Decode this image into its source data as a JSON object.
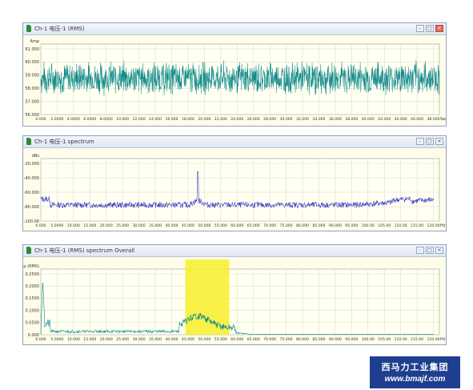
{
  "windows": [
    {
      "title": "Ch-1 电压-1 (RMS)",
      "buttons": [
        "-",
        "□",
        "×"
      ]
    },
    {
      "title": "Ch-1 电压-1 spectrum",
      "buttons": [
        "-",
        "□",
        "×"
      ]
    },
    {
      "title": "Ch-1 电压-1 (RMS) spectrum Overall",
      "buttons": [
        "-",
        "□",
        "×"
      ]
    }
  ],
  "chart_data": [
    {
      "type": "line",
      "ylabel": "Amp",
      "yticks": [
        "61.000",
        "60.000",
        "59.000",
        "58.000",
        "57.000",
        "56.000"
      ],
      "xticks": [
        "0.000",
        "2.0000",
        "4.0000",
        "6.0000",
        "8.0000",
        "10.000",
        "12.000",
        "14.000",
        "16.000",
        "18.000",
        "20.000",
        "22.000",
        "24.000",
        "26.000",
        "28.000",
        "30.000",
        "32.000",
        "34.000",
        "36.000",
        "38.000",
        "40.000",
        "42.000",
        "44.000",
        "46.000",
        "48.000"
      ],
      "xunit": "Sec",
      "ylim": [
        55.5,
        61.5
      ],
      "xlim": [
        0,
        50
      ],
      "series": [
        {
          "mean": 58.6,
          "amplitude": 1.6,
          "color": "#0f8a8a"
        }
      ],
      "grid": true
    },
    {
      "type": "line",
      "ylabel": "dBs",
      "yticks": [
        "-20.000",
        "-40.000",
        "-60.000",
        "-80.000",
        "-100.00"
      ],
      "xticks": [
        "0.000",
        "5.0000",
        "10.000",
        "15.000",
        "20.000",
        "25.000",
        "30.000",
        "35.000",
        "40.000",
        "45.000",
        "50.000",
        "55.000",
        "60.000",
        "65.000",
        "70.000",
        "75.000",
        "80.000",
        "85.000",
        "90.000",
        "95.000",
        "100.00",
        "105.00",
        "110.00",
        "115.00",
        "120.00"
      ],
      "xunit": "Hz",
      "ylim": [
        -105,
        0
      ],
      "xlim": [
        0,
        125
      ],
      "peak": {
        "x": 50,
        "y": -22
      },
      "series": [
        {
          "baseline": -78,
          "color": "#2c2cc9"
        }
      ],
      "grid": true
    },
    {
      "type": "line",
      "ylabel": "Amp (RMS)",
      "yticks": [
        "0.2500",
        "0.2000",
        "0.1500",
        "0.1000",
        "0.0500",
        "0.000"
      ],
      "xticks": [
        "0.000",
        "5.0000",
        "10.000",
        "15.000",
        "20.000",
        "25.000",
        "30.000",
        "35.000",
        "40.000",
        "45.000",
        "50.000",
        "55.000",
        "60.000",
        "65.000",
        "70.000",
        "75.000",
        "80.000",
        "85.000",
        "90.000",
        "95.000",
        "100.00",
        "105.00",
        "110.00",
        "115.00",
        "120.00"
      ],
      "xunit": "Hz",
      "ylim": [
        0,
        0.28
      ],
      "xlim": [
        0,
        125
      ],
      "highlight": {
        "x0": 46,
        "x1": 60,
        "color": "#f7f02a"
      },
      "series": [
        {
          "color": "#0f8a8a"
        }
      ],
      "grid": true
    }
  ],
  "brand": {
    "name": "西马力工业集团",
    "url": "www.bmajf.com"
  }
}
